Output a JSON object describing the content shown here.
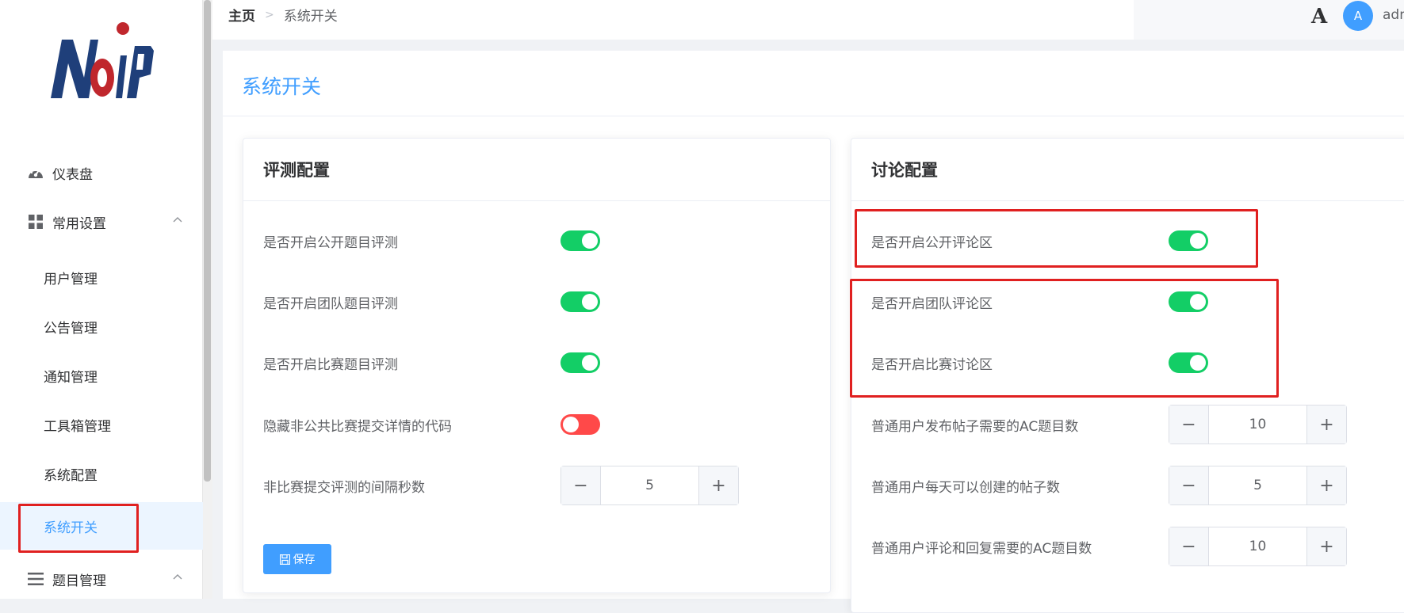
{
  "breadcrumb": {
    "home": "主页",
    "current": "系统开关"
  },
  "header": {
    "font_icon": "A",
    "avatar_letter": "A",
    "username": "admin"
  },
  "sidebar": {
    "items": [
      {
        "label": "仪表盘",
        "icon": "dashboard-icon"
      },
      {
        "label": "常用设置",
        "icon": "grid-icon",
        "expanded": true
      },
      {
        "label": "用户管理"
      },
      {
        "label": "公告管理"
      },
      {
        "label": "通知管理"
      },
      {
        "label": "工具箱管理"
      },
      {
        "label": "系统配置"
      },
      {
        "label": "系统开关",
        "active": true
      },
      {
        "label": "题目管理",
        "icon": "list-icon",
        "expanded": true
      }
    ]
  },
  "page": {
    "title": "系统开关"
  },
  "judge_panel": {
    "title": "评测配置",
    "rows": [
      {
        "label": "是否开启公开题目评测",
        "on": true
      },
      {
        "label": "是否开启团队题目评测",
        "on": true
      },
      {
        "label": "是否开启比赛题目评测",
        "on": true
      },
      {
        "label": "隐藏非公共比赛提交详情的代码",
        "on": false
      },
      {
        "label": "非比赛提交评测的间隔秒数",
        "value": "5"
      }
    ],
    "save_label": "保存"
  },
  "discuss_panel": {
    "title": "讨论配置",
    "rows": [
      {
        "label": "是否开启公开评论区",
        "on": true
      },
      {
        "label": "是否开启团队评论区",
        "on": true
      },
      {
        "label": "是否开启比赛讨论区",
        "on": true
      },
      {
        "label": "普通用户发布帖子需要的AC题目数",
        "value": "10"
      },
      {
        "label": "普通用户每天可以创建的帖子数",
        "value": "5"
      },
      {
        "label": "普通用户评论和回复需要的AC题目数",
        "value": "10"
      }
    ]
  },
  "colors": {
    "accent": "#409eff",
    "switch_on": "#13ce66",
    "switch_off": "#ff4949",
    "highlight": "#e02020"
  }
}
